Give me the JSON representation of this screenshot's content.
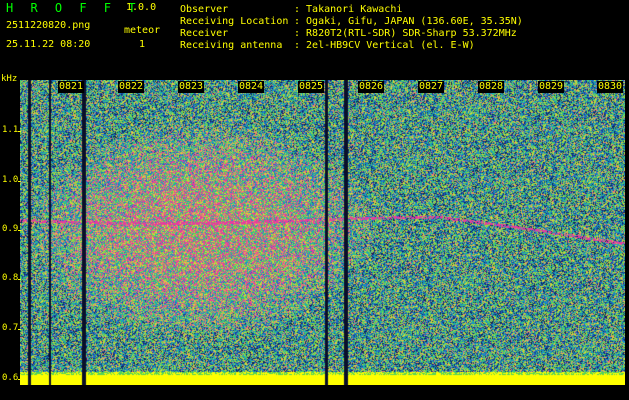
{
  "app": {
    "title": "H R O F F T",
    "version": "1.0.0"
  },
  "file_name": "2511220820.png",
  "datetime": "25.11.22 08:20",
  "detection": {
    "label": "meteor",
    "count": "1"
  },
  "station_info": [
    {
      "key": "Observer",
      "value": ": Takanori Kawachi"
    },
    {
      "key": "Receiving Location",
      "value": ": Ogaki, Gifu, JAPAN (136.60E, 35.35N)"
    },
    {
      "key": "Receiver",
      "value": ": R820T2(RTL-SDR) SDR-Sharp 53.372MHz"
    },
    {
      "key": "Receiving antenna",
      "value": ": 2el-HB9CV Vertical (el. E-W)"
    }
  ],
  "y_axis": {
    "unit": "kHz",
    "ticks": [
      "1.1",
      "1.0",
      "0.9",
      "0.8",
      "0.7",
      "0.6"
    ]
  },
  "x_axis": {
    "ticks": [
      "0821",
      "0822",
      "0823",
      "0824",
      "0825",
      "0826",
      "0827",
      "0828",
      "0829",
      "0830"
    ]
  },
  "colors": {
    "label": "#ffff00",
    "title": "#00ff00",
    "background": "#000000"
  }
}
